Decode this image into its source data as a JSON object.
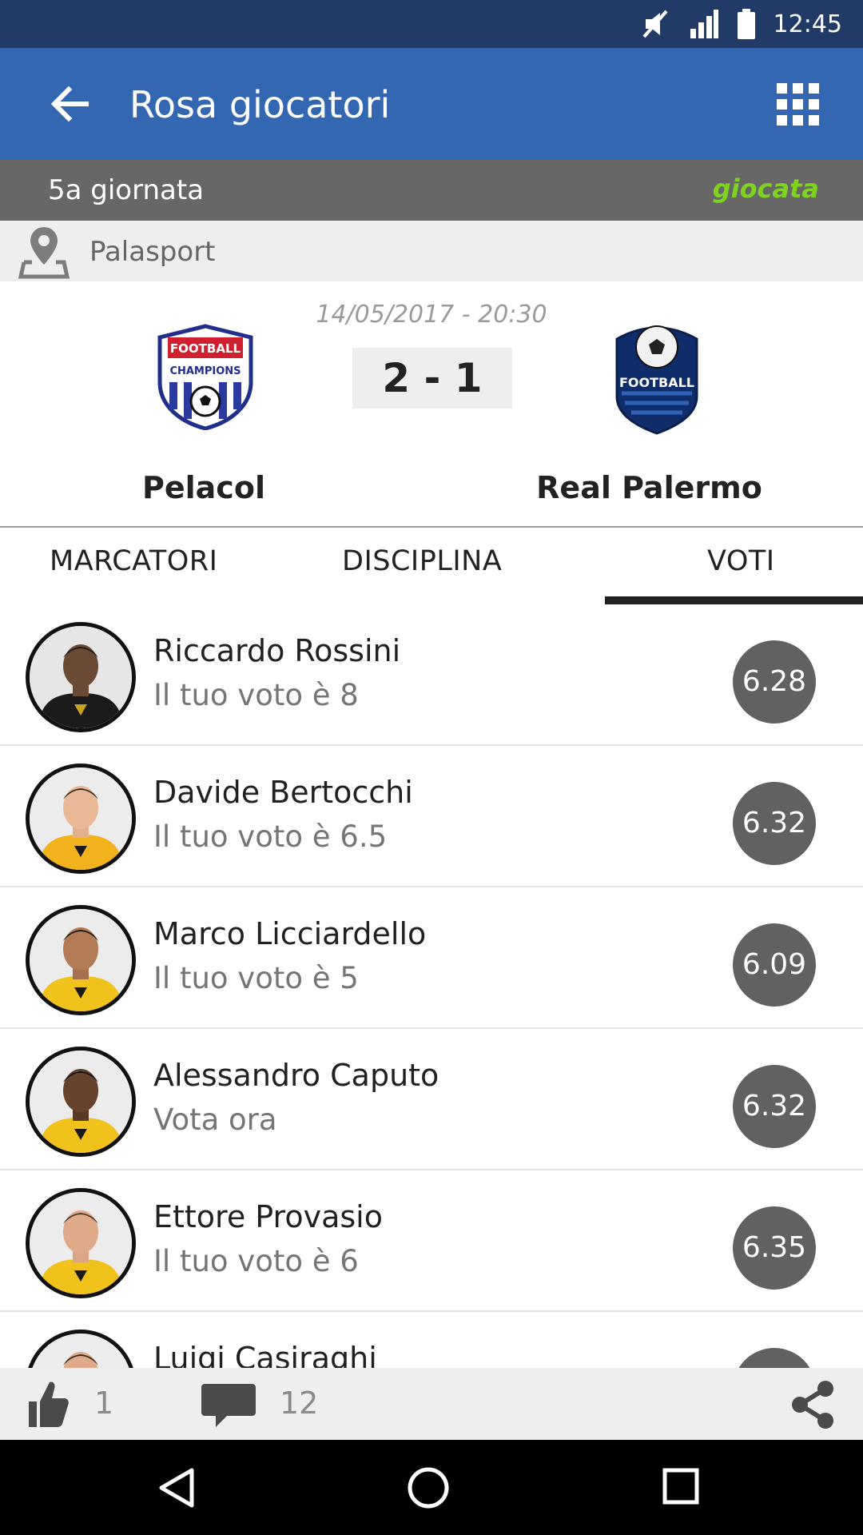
{
  "status_bar": {
    "time": "12:45",
    "icons": [
      "mute-icon",
      "signal-icon",
      "battery-icon"
    ]
  },
  "app_bar": {
    "title": "Rosa giocatori",
    "back_icon": "arrow-left-icon",
    "menu_icon": "grid-icon"
  },
  "round": {
    "label": "5a giornata",
    "status": "giocata",
    "status_color": "#7ed321"
  },
  "venue": {
    "label": "Palasport",
    "icon": "map-pin-icon"
  },
  "match": {
    "datetime": "14/05/2017 - 20:30",
    "score": "2 - 1",
    "home": {
      "name": "Pelacol",
      "logo_text_1": "FOOTBALL",
      "logo_text_2": "CHAMPIONS"
    },
    "away": {
      "name": "Real Palermo",
      "logo_text": "FOOTBALL"
    }
  },
  "tabs": [
    {
      "label": "MARCATORI",
      "active": false
    },
    {
      "label": "DISCIPLINA",
      "active": false
    },
    {
      "label": "VOTI",
      "active": true
    }
  ],
  "players": [
    {
      "name": "Riccardo Rossini",
      "subtitle": "Il tuo voto è 8",
      "rating": "6.28",
      "kit": "black"
    },
    {
      "name": "Davide Bertocchi",
      "subtitle": "Il tuo voto è 6.5",
      "rating": "6.32",
      "kit": "yellow"
    },
    {
      "name": "Marco Licciardello",
      "subtitle": "Il tuo voto è 5",
      "rating": "6.09",
      "kit": "yellow"
    },
    {
      "name": "Alessandro Caputo",
      "subtitle": "Vota ora",
      "rating": "6.32",
      "kit": "yellow"
    },
    {
      "name": "Ettore Provasio",
      "subtitle": "Il tuo voto è 6",
      "rating": "6.35",
      "kit": "yellow"
    },
    {
      "name": "Luigi Casiraghi",
      "subtitle": "",
      "rating": "",
      "kit": "yellow"
    }
  ],
  "actions": {
    "likes": "1",
    "comments": "12",
    "like_icon": "thumbs-up-icon",
    "comment_icon": "comment-icon",
    "share_icon": "share-icon"
  },
  "colors": {
    "app_bar": "#3367b1",
    "status_bar": "#213a66",
    "round_bar": "#676767",
    "rating_badge": "#616161"
  }
}
